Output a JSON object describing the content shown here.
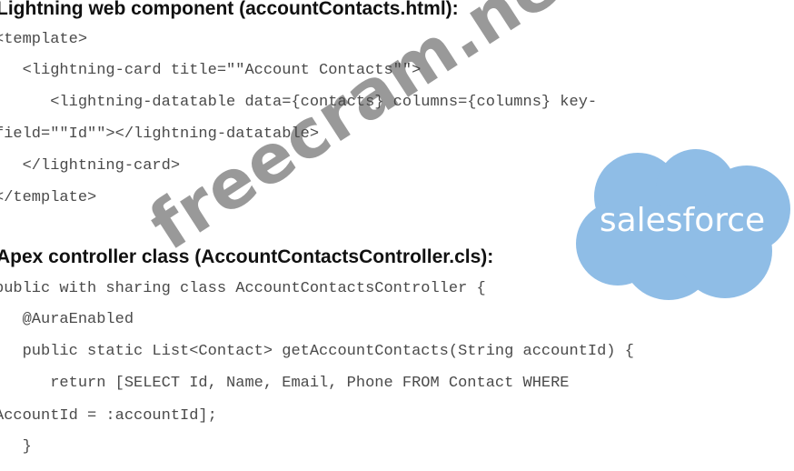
{
  "document": {
    "heading_lwc": "Lightning web component (accountContacts.html):",
    "lwc_code": [
      "<template>",
      "   <lightning-card title=\"\"Account Contacts\"\">",
      "      <lightning-datatable data={contacts} columns={columns} key-",
      "field=\"\"Id\"\"></lightning-datatable>",
      "   </lightning-card>",
      "</template>"
    ],
    "heading_apex": "Apex controller class (AccountContactsController.cls):",
    "apex_code": [
      "public with sharing class AccountContactsController {",
      "   @AuraEnabled",
      "   public static List<Contact> getAccountContacts(String accountId) {",
      "      return [SELECT Id, Name, Email, Phone FROM Contact WHERE",
      "AccountId = :accountId];",
      "   }"
    ]
  },
  "watermark": {
    "text": "freecram.net"
  },
  "logo": {
    "text": "salesforce",
    "color": "#8fbde6"
  }
}
